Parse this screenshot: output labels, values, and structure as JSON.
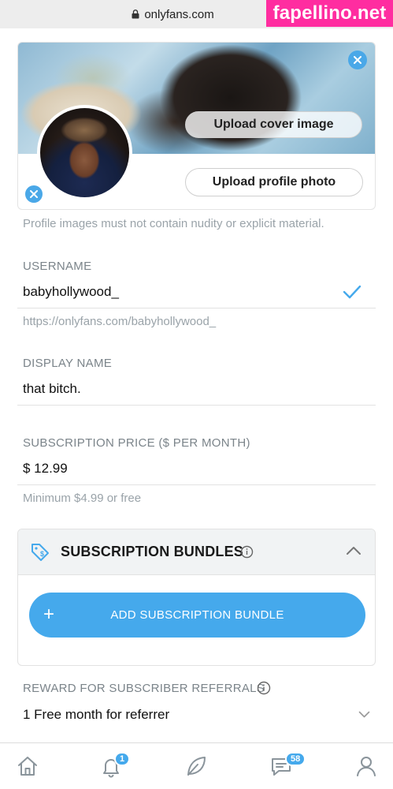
{
  "browser": {
    "url": "onlyfans.com"
  },
  "watermark": "fapellino.net",
  "profile_card": {
    "upload_cover_label": "Upload cover image",
    "upload_profile_label": "Upload profile photo"
  },
  "image_hint": "Profile images must not contain nudity or explicit material.",
  "username": {
    "label": "USERNAME",
    "value": "babyhollywood_",
    "url": "https://onlyfans.com/babyhollywood_"
  },
  "display_name": {
    "label": "DISPLAY NAME",
    "value": "that bitch."
  },
  "subscription": {
    "label": "SUBSCRIPTION PRICE ($ PER MONTH)",
    "value": "$ 12.99",
    "hint": "Minimum $4.99 or free"
  },
  "bundles": {
    "title": "SUBSCRIPTION BUNDLES",
    "add_label": "ADD SUBSCRIPTION BUNDLE",
    "add_icon": "+"
  },
  "referral": {
    "label": "REWARD FOR SUBSCRIBER REFERRALS",
    "value": "1 Free month for referrer"
  },
  "bottom_nav": {
    "items": [
      {
        "icon": "home-icon"
      },
      {
        "icon": "bell-icon",
        "badge": "1"
      },
      {
        "icon": "leaf-icon"
      },
      {
        "icon": "messages-icon",
        "badge": "58"
      },
      {
        "icon": "profile-icon"
      }
    ]
  },
  "colors": {
    "accent": "#45a9ec",
    "watermark": "#ff2da0"
  }
}
